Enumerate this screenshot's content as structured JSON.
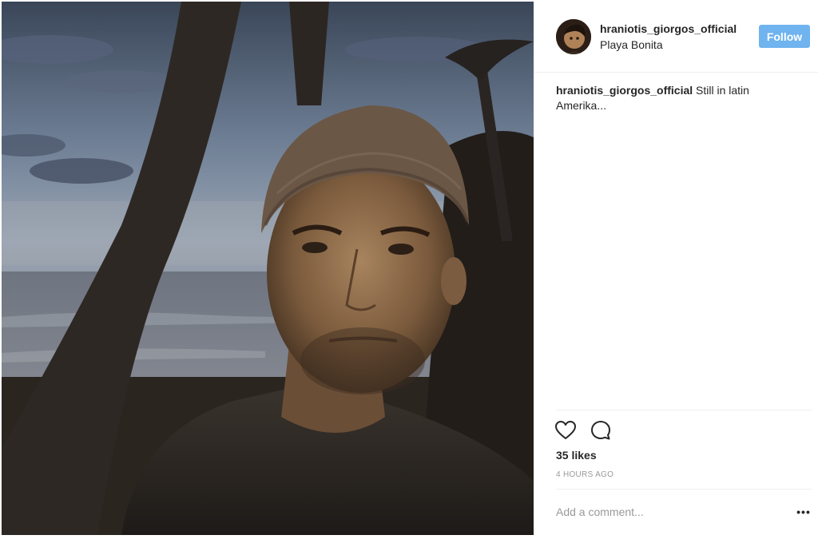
{
  "post": {
    "username": "hraniotis_giorgos_official",
    "location": "Playa Bonita",
    "follow_label": "Follow",
    "caption_user": "hraniotis_giorgos_official",
    "caption_text": "Still in latin Amerika...",
    "likes": "35 likes",
    "timestamp": "4 HOURS AGO",
    "comment_placeholder": "Add a comment...",
    "more_label": "•••"
  },
  "icons": {
    "like": "heart-icon",
    "comment": "comment-bubble-icon",
    "more": "more-options-icon"
  },
  "colors": {
    "follow_button": "#6fb3ef",
    "text": "#262626",
    "muted": "#999999",
    "divider": "#efefef"
  }
}
